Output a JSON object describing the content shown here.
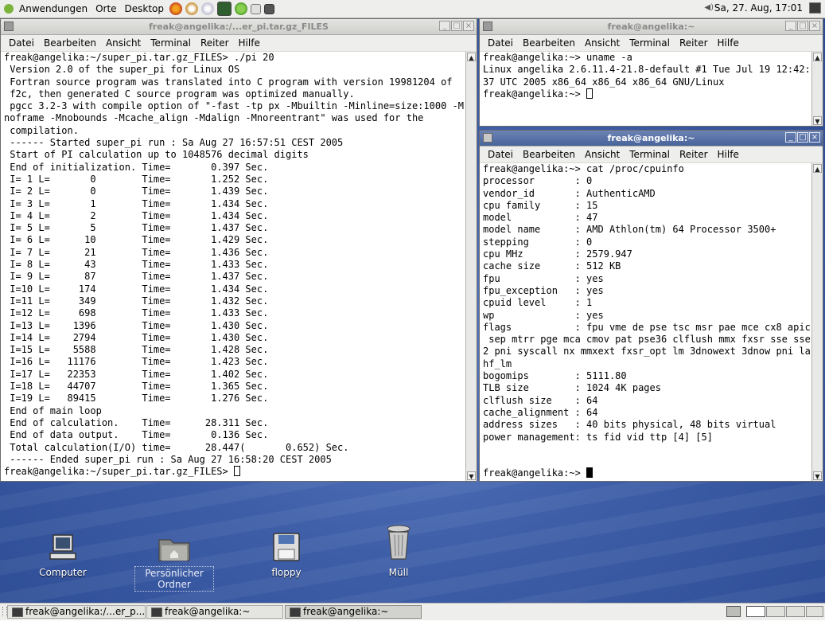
{
  "top_panel": {
    "menus": [
      "Anwendungen",
      "Orte",
      "Desktop"
    ],
    "clock": "Sa, 27. Aug, 17:01"
  },
  "windows": {
    "left": {
      "title": "freak@angelika:/...er_pi.tar.gz_FILES",
      "menu": [
        "Datei",
        "Bearbeiten",
        "Ansicht",
        "Terminal",
        "Reiter",
        "Hilfe"
      ],
      "lines": [
        "freak@angelika:~/super_pi.tar.gz_FILES> ./pi 20",
        " Version 2.0 of the super_pi for Linux OS",
        " Fortran source program was translated into C program with version 19981204 of",
        " f2c, then generated C source program was optimized manually.",
        " pgcc 3.2-3 with compile option of \"-fast -tp px -Mbuiltin -Minline=size:1000 -M",
        "noframe -Mnobounds -Mcache_align -Mdalign -Mnoreentrant\" was used for the",
        " compilation.",
        " ------ Started super_pi run : Sa Aug 27 16:57:51 CEST 2005",
        " Start of PI calculation up to 1048576 decimal digits",
        " End of initialization. Time=       0.397 Sec.",
        " I= 1 L=       0        Time=       1.252 Sec.",
        " I= 2 L=       0        Time=       1.439 Sec.",
        " I= 3 L=       1        Time=       1.434 Sec.",
        " I= 4 L=       2        Time=       1.434 Sec.",
        " I= 5 L=       5        Time=       1.437 Sec.",
        " I= 6 L=      10        Time=       1.429 Sec.",
        " I= 7 L=      21        Time=       1.436 Sec.",
        " I= 8 L=      43        Time=       1.433 Sec.",
        " I= 9 L=      87        Time=       1.437 Sec.",
        " I=10 L=     174        Time=       1.434 Sec.",
        " I=11 L=     349        Time=       1.432 Sec.",
        " I=12 L=     698        Time=       1.433 Sec.",
        " I=13 L=    1396        Time=       1.430 Sec.",
        " I=14 L=    2794        Time=       1.430 Sec.",
        " I=15 L=    5588        Time=       1.428 Sec.",
        " I=16 L=   11176        Time=       1.423 Sec.",
        " I=17 L=   22353        Time=       1.402 Sec.",
        " I=18 L=   44707        Time=       1.365 Sec.",
        " I=19 L=   89415        Time=       1.276 Sec.",
        " End of main loop",
        " End of calculation.    Time=      28.311 Sec.",
        " End of data output.    Time=       0.136 Sec.",
        " Total calculation(I/O) time=      28.447(       0.652) Sec.",
        " ------ Ended super_pi run : Sa Aug 27 16:58:20 CEST 2005"
      ],
      "prompt": "freak@angelika:~/super_pi.tar.gz_FILES> "
    },
    "top_right": {
      "title": "freak@angelika:~",
      "menu": [
        "Datei",
        "Bearbeiten",
        "Ansicht",
        "Terminal",
        "Reiter",
        "Hilfe"
      ],
      "lines": [
        "freak@angelika:~> uname -a",
        "Linux angelika 2.6.11.4-21.8-default #1 Tue Jul 19 12:42:",
        "37 UTC 2005 x86_64 x86_64 x86_64 GNU/Linux"
      ],
      "prompt": "freak@angelika:~> "
    },
    "bottom_right": {
      "title": "freak@angelika:~",
      "menu": [
        "Datei",
        "Bearbeiten",
        "Ansicht",
        "Terminal",
        "Reiter",
        "Hilfe"
      ],
      "lines": [
        "freak@angelika:~> cat /proc/cpuinfo",
        "processor       : 0",
        "vendor_id       : AuthenticAMD",
        "cpu family      : 15",
        "model           : 47",
        "model name      : AMD Athlon(tm) 64 Processor 3500+",
        "stepping        : 0",
        "cpu MHz         : 2579.947",
        "cache size      : 512 KB",
        "fpu             : yes",
        "fpu_exception   : yes",
        "cpuid level     : 1",
        "wp              : yes",
        "flags           : fpu vme de pse tsc msr pae mce cx8 apic",
        " sep mtrr pge mca cmov pat pse36 clflush mmx fxsr sse sse",
        "2 pni syscall nx mmxext fxsr_opt lm 3dnowext 3dnow pni la",
        "hf_lm",
        "bogomips        : 5111.80",
        "TLB size        : 1024 4K pages",
        "clflush size    : 64",
        "cache_alignment : 64",
        "address sizes   : 40 bits physical, 48 bits virtual",
        "power management: ts fid vid ttp [4] [5]",
        "",
        ""
      ],
      "prompt": "freak@angelika:~> "
    }
  },
  "desktop_icons": [
    {
      "label": "Computer"
    },
    {
      "label": "Persönlicher Ordner"
    },
    {
      "label": "floppy"
    },
    {
      "label": "Müll"
    }
  ],
  "taskbar": [
    {
      "label": "freak@angelika:/...er_p..."
    },
    {
      "label": "freak@angelika:~"
    },
    {
      "label": "freak@angelika:~"
    }
  ]
}
